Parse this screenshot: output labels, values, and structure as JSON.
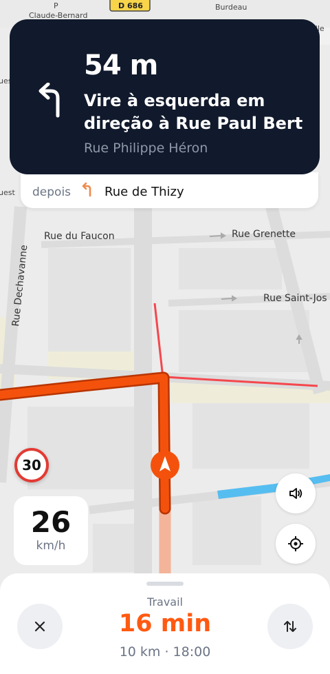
{
  "map": {
    "top_labels": {
      "claude_bernard": "Claude-Bernard",
      "road_sign": "D 686",
      "parking": "P",
      "bureau": "Burdeau",
      "left_edge_1": "ues",
      "left_edge_2": "uest",
      "right_edge": "elle"
    },
    "streets": {
      "faucon": "Rue du Faucon",
      "grenette": "Rue Grenette",
      "dechavanne": "Rue Dechavanne",
      "saint_jos": "Rue Saint-Jos"
    }
  },
  "maneuver": {
    "distance": "54 m",
    "instruction": "Vire à esquerda em direção à Rue Paul Bert",
    "current_street": "Rue Philippe Héron",
    "icon": "turn-left-arrow-icon"
  },
  "next_maneuver": {
    "label": "depois",
    "icon": "turn-left-arrow-icon",
    "street": "Rue de Thizy"
  },
  "speed": {
    "limit": "30",
    "current": "26",
    "unit": "km/h"
  },
  "map_controls": {
    "volume_icon": "speaker-icon",
    "recenter_icon": "crosshair-icon"
  },
  "trip": {
    "destination": "Travail",
    "duration": "16 min",
    "details": "10 km · 18:00"
  },
  "colors": {
    "route": "#f4520c",
    "nav_card": "#111a2c",
    "accent": "#ff5a12",
    "speed_limit_border": "#e23b34"
  }
}
